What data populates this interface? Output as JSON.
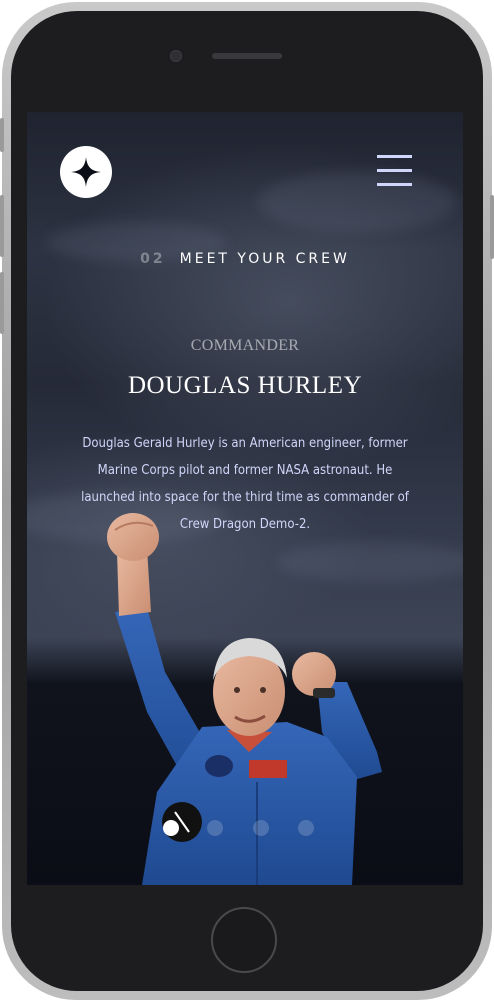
{
  "header": {
    "logo_icon": "star-logo-icon",
    "menu_icon": "hamburger-menu-icon"
  },
  "section": {
    "number": "02",
    "title": "MEET YOUR CREW"
  },
  "crew": {
    "role": "COMMANDER",
    "name": "DOUGLAS HURLEY",
    "bio": "Douglas Gerald Hurley is an American engineer, former Marine Corps pilot and former NASA astronaut. He launched into space for the third time as commander of Crew Dragon Demo-2."
  },
  "pagination": {
    "count": 4,
    "active_index": 0
  },
  "colors": {
    "accent": "#d0d6f9",
    "text": "#ffffff",
    "suit_blue": "#2b5aa8"
  }
}
